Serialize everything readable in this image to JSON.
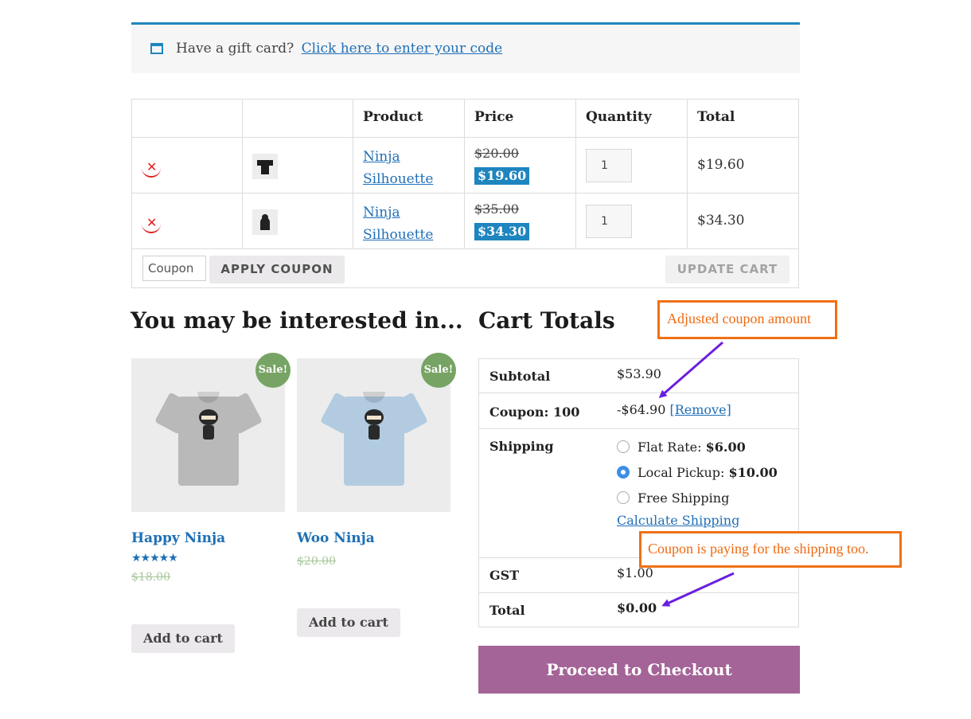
{
  "notice": {
    "text": "Have a gift card?",
    "link": "Click here to enter your code",
    "icon": "gift-card-icon",
    "accent": "#1e85be"
  },
  "cart": {
    "headers": [
      "Product",
      "Price",
      "Quantity",
      "Total"
    ],
    "rows": [
      {
        "name_line1": "Ninja",
        "name_line2": "Silhouette",
        "old_price": "$20.00",
        "price": "$19.60",
        "qty": "1",
        "total": "$19.60",
        "thumb": "t-shirt-thumbnail"
      },
      {
        "name_line1": "Ninja",
        "name_line2": "Silhouette",
        "old_price": "$35.00",
        "price": "$34.30",
        "qty": "1",
        "total": "$34.30",
        "thumb": "hoodie-thumbnail"
      }
    ],
    "coupon_placeholder": "Coupon",
    "apply_label": "APPLY COUPON",
    "update_label": "UPDATE CART"
  },
  "related": {
    "heading": "You may be interested in...",
    "products": [
      {
        "title": "Happy Ninja",
        "sale": "Sale!",
        "old_price": "$18.00",
        "rating": 5,
        "stars": "★★★★★",
        "button": "Add to cart",
        "shirt_color": "#b9b9b9"
      },
      {
        "title": "Woo Ninja",
        "sale": "Sale!",
        "old_price": "$20.00",
        "button": "Add to cart",
        "shirt_color": "#b2cbe0"
      }
    ]
  },
  "totals": {
    "heading": "Cart Totals",
    "subtotal_label": "Subtotal",
    "subtotal": "$53.90",
    "coupon_label": "Coupon: 100",
    "coupon_value": "-$64.90",
    "remove_label": "[Remove]",
    "shipping_label": "Shipping",
    "shipping_options": [
      {
        "name": "Flat Rate:",
        "price": "$6.00",
        "selected": false
      },
      {
        "name": "Local Pickup:",
        "price": "$10.00",
        "selected": true
      },
      {
        "name": "Free Shipping",
        "price": "",
        "selected": false
      }
    ],
    "calc_shipping": "Calculate Shipping",
    "tax_label": "GST",
    "tax": "$1.00",
    "total_label": "Total",
    "total": "$0.00"
  },
  "checkout_label": "Proceed to Checkout",
  "annotations": {
    "callout1": "Adjusted coupon amount",
    "callout2": "Coupon is paying for the shipping too.",
    "callout_color": "#f07016",
    "arrow_color": "#6a1ee0"
  }
}
